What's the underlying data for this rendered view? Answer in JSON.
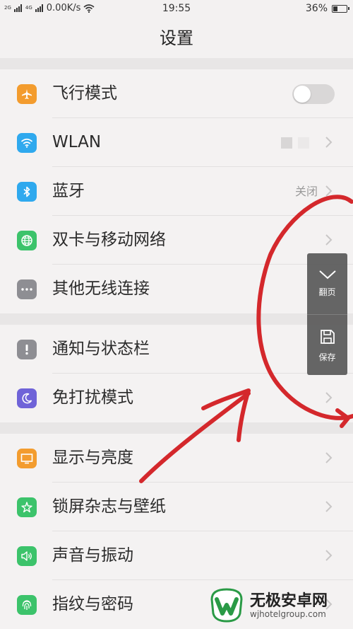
{
  "status_bar": {
    "signal_text": "2G",
    "network_text": "4G",
    "speed": "0.00K/s",
    "time": "19:55",
    "battery": "36%",
    "battery_level": 0.36
  },
  "header": {
    "title": "设置"
  },
  "sections": [
    {
      "items": [
        {
          "label": "飞行模式",
          "icon": "airplane-icon",
          "color": "#f39c2e",
          "control": "toggle",
          "toggle_on": false
        },
        {
          "label": "WLAN",
          "icon": "wifi-icon",
          "color": "#2fa9ee",
          "control": "chevron"
        },
        {
          "label": "蓝牙",
          "icon": "bluetooth-icon",
          "color": "#2fa9ee",
          "control": "chevron",
          "value": "关闭"
        },
        {
          "label": "双卡与移动网络",
          "icon": "globe-icon",
          "color": "#3cc36b",
          "control": "chevron"
        },
        {
          "label": "其他无线连接",
          "icon": "more-dots-icon",
          "color": "#8e8e93",
          "control": "chevron"
        }
      ]
    },
    {
      "items": [
        {
          "label": "通知与状态栏",
          "icon": "exclamation-icon",
          "color": "#8e8e93",
          "control": "chevron"
        },
        {
          "label": "免打扰模式",
          "icon": "moon-icon",
          "color": "#6f63d8",
          "control": "chevron"
        }
      ]
    },
    {
      "items": [
        {
          "label": "显示与亮度",
          "icon": "monitor-icon",
          "color": "#f39c2e",
          "control": "chevron"
        },
        {
          "label": "锁屏杂志与壁纸",
          "icon": "flower-icon",
          "color": "#3cc36b",
          "control": "chevron"
        },
        {
          "label": "声音与振动",
          "icon": "speaker-icon",
          "color": "#3cc36b",
          "control": "chevron"
        },
        {
          "label": "指纹与密码",
          "icon": "fingerprint-icon",
          "color": "#3cc36b",
          "control": "chevron"
        }
      ]
    }
  ],
  "float_panel": {
    "page_label": "翻页",
    "save_label": "保存"
  },
  "watermark": {
    "title": "无极安卓网",
    "url": "wjhotelgroup.com"
  },
  "colors": {
    "annotation_red": "#d4282c",
    "background": "#f4f2f2"
  }
}
